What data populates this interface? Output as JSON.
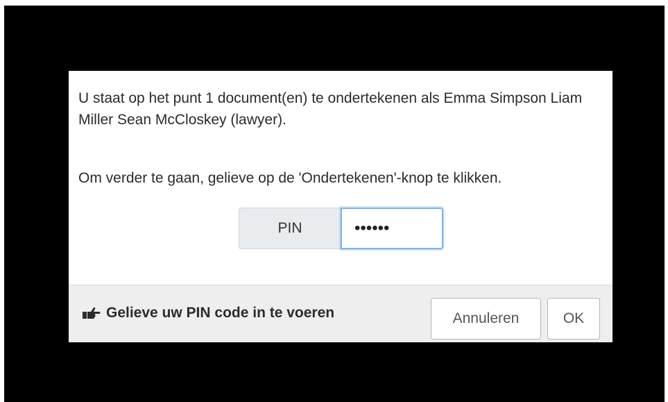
{
  "dialog": {
    "message": "U staat op het punt 1 document(en) te ondertekenen als Emma Simpson Liam Miller Sean McCloskey (lawyer).",
    "instruction": "Om verder te gaan, gelieve op de 'Ondertekenen'-knop te klikken.",
    "pin": {
      "label": "PIN",
      "value": "••••••"
    }
  },
  "footer": {
    "hint": "Gelieve uw PIN code in te voeren",
    "hint_icon": "hand-pointing-right-icon",
    "cancel_label": "Annuleren",
    "ok_label": "OK"
  },
  "colors": {
    "overlay": "#000000",
    "footer_background": "#eeeeee",
    "input_focus": "#7fb3e8",
    "pin_label_background": "#e9ecef"
  }
}
